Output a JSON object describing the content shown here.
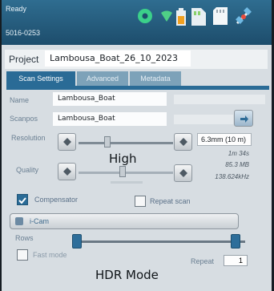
{
  "status": {
    "state": "Ready",
    "serial": "5016-0253"
  },
  "topbar_icons": [
    "settings-icon",
    "wifi-icon",
    "battery-icon",
    "sd-card-icon",
    "memory-card-icon",
    "satellite-icon"
  ],
  "colors": {
    "accent": "#2a6b96",
    "topbar": "#2a6a90",
    "panel": "#d7dde2"
  },
  "project": {
    "label": "Project",
    "value": "Lambousa_Boat_26_10_2023"
  },
  "tabs": [
    {
      "label": "Scan Settings",
      "active": true
    },
    {
      "label": "Advanced",
      "active": false
    },
    {
      "label": "Metadata",
      "active": false
    }
  ],
  "fields": {
    "name": {
      "label": "Name",
      "value": "Lambousa_Boat"
    },
    "scanpos": {
      "label": "Scanpos",
      "value": "Lambousa_Boat"
    }
  },
  "resolution": {
    "label": "Resolution",
    "value": "6.3mm (10 m)",
    "time": "1m 34s",
    "size": "85.3 MB",
    "rate": "138.624kHz",
    "overlay": "High"
  },
  "quality": {
    "label": "Quality"
  },
  "compensator": {
    "label": "Compensator",
    "checked": true
  },
  "repeat_scan": {
    "label": "Repeat scan",
    "checked": false
  },
  "camera": {
    "label": "i-Cam"
  },
  "rows": {
    "label": "Rows"
  },
  "fast_mode": {
    "label": "Fast mode",
    "checked": false
  },
  "repeat": {
    "label": "Repeat",
    "value": "1"
  },
  "annotation": "HDR Mode"
}
